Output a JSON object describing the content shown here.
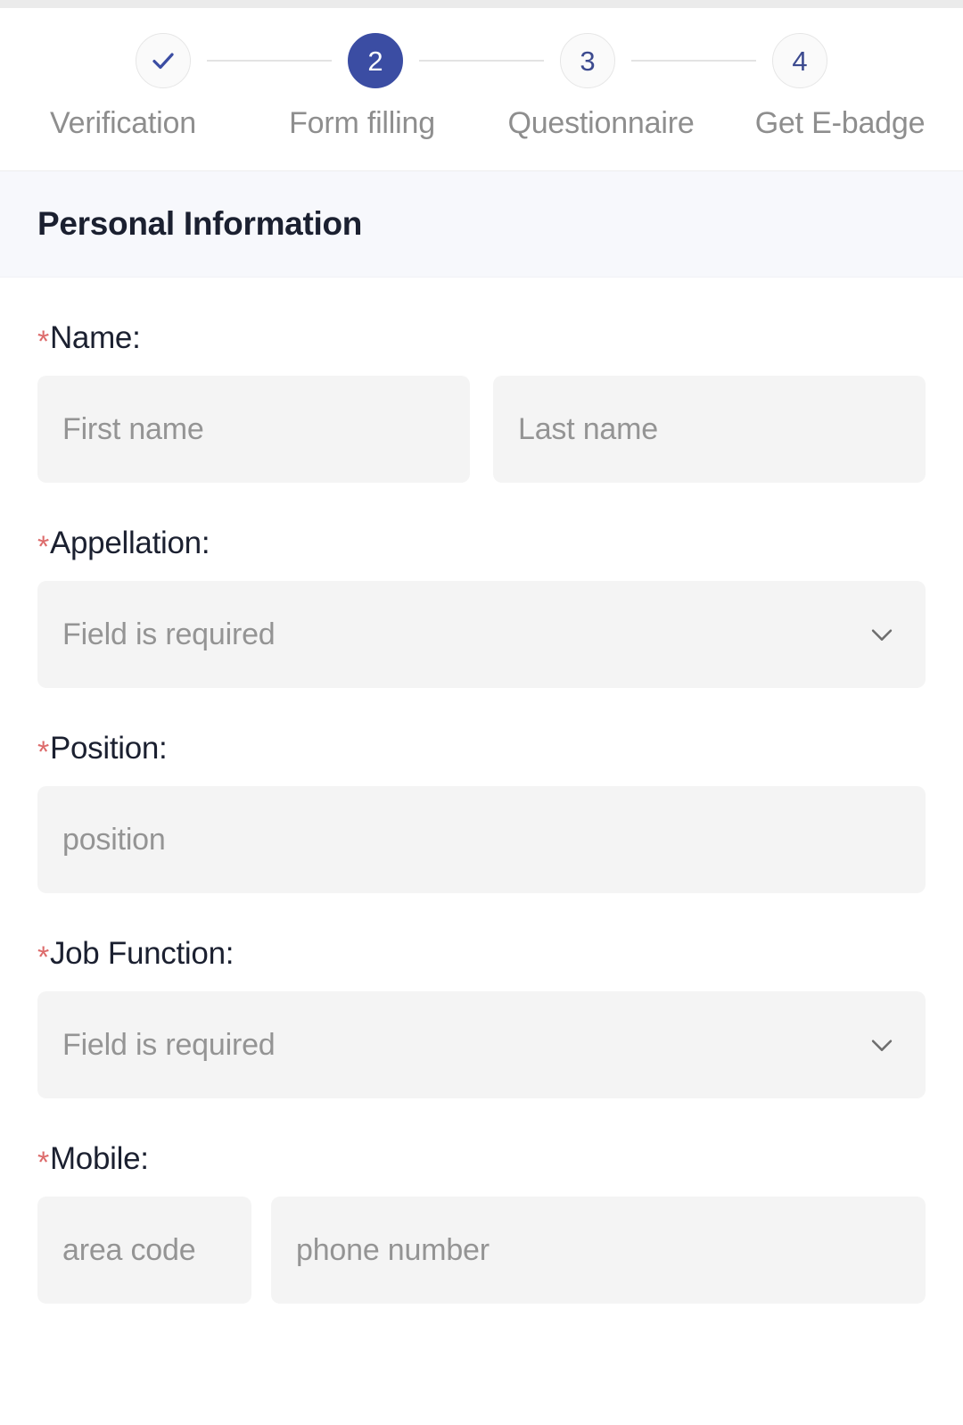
{
  "stepper": {
    "steps": [
      {
        "indicator": "check",
        "label": "Verification",
        "state": "completed"
      },
      {
        "indicator": "2",
        "label": "Form filling",
        "state": "active"
      },
      {
        "indicator": "3",
        "label": "Questionnaire",
        "state": "upcoming"
      },
      {
        "indicator": "4",
        "label": "Get E-badge",
        "state": "upcoming"
      }
    ],
    "active_step_number": "2"
  },
  "section": {
    "title": "Personal Information"
  },
  "form": {
    "name": {
      "label": "Name:",
      "required_marker": "*",
      "first_name_placeholder": "First name",
      "first_name_value": "",
      "last_name_placeholder": "Last name",
      "last_name_value": ""
    },
    "appellation": {
      "label": "Appellation:",
      "required_marker": "*",
      "placeholder": "Field is required",
      "value": "",
      "icon": "chevron-down-icon"
    },
    "position": {
      "label": "Position:",
      "required_marker": "*",
      "placeholder": "position",
      "value": ""
    },
    "job_function": {
      "label": "Job Function:",
      "required_marker": "*",
      "placeholder": "Field is required",
      "value": "",
      "icon": "chevron-down-icon"
    },
    "mobile": {
      "label": "Mobile:",
      "required_marker": "*",
      "area_code_placeholder": "area code",
      "area_code_value": "",
      "phone_placeholder": "phone number",
      "phone_value": ""
    }
  },
  "colors": {
    "accent": "#3b4da3",
    "required_star": "#dd6b6b",
    "label_text": "#1b2030",
    "placeholder_text": "#949494",
    "input_bg": "#f4f4f4",
    "section_band_bg": "#f7f8fc",
    "step_label": "#8e8e8e"
  }
}
